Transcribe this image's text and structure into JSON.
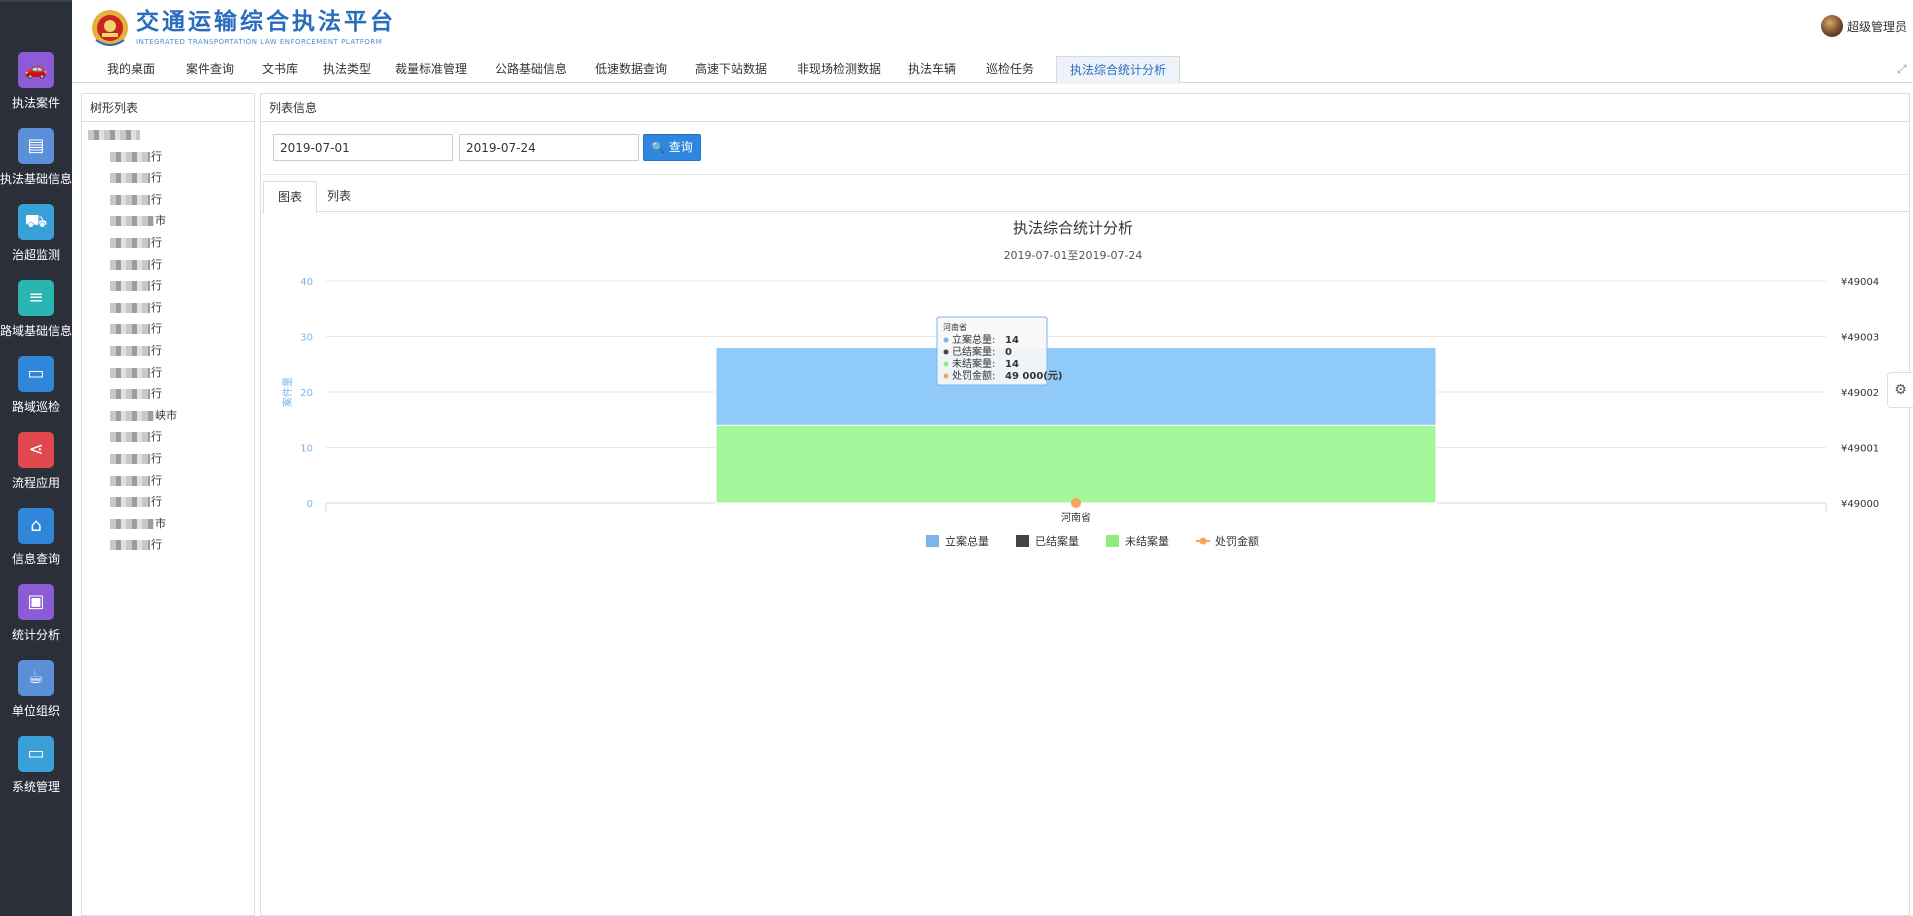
{
  "header": {
    "title_cn": "交通运输综合执法平台",
    "title_en": "INTEGRATED TRANSPORTATION LAW ENFORCEMENT PLATFORM",
    "user_name": "超级管理员"
  },
  "sidebar": {
    "items": [
      {
        "label": "执法案件",
        "icon": "car-icon",
        "color": "#8b5cd6"
      },
      {
        "label": "执法基础信息",
        "icon": "id-card-icon",
        "color": "#5b8fd8"
      },
      {
        "label": "治超监测",
        "icon": "truck-icon",
        "color": "#3aa0d8"
      },
      {
        "label": "路域基础信息",
        "icon": "list-icon",
        "color": "#2bb5b0"
      },
      {
        "label": "路域巡检",
        "icon": "monitor-icon",
        "color": "#2f86d8"
      },
      {
        "label": "流程应用",
        "icon": "share-icon",
        "color": "#e0484e"
      },
      {
        "label": "信息查询",
        "icon": "bath-icon",
        "color": "#2f86d8"
      },
      {
        "label": "统计分析",
        "icon": "chip-icon",
        "color": "#8b5cd6"
      },
      {
        "label": "单位组织",
        "icon": "coffee-icon",
        "color": "#5b8fd8"
      },
      {
        "label": "系统管理",
        "icon": "monitor-icon",
        "color": "#3aa0d8"
      }
    ]
  },
  "nav": {
    "tabs": [
      "我的桌面",
      "案件查询",
      "文书库",
      "执法类型",
      "裁量标准管理",
      "公路基础信息",
      "低速数据查询",
      "高速下站数据",
      "非现场检测数据",
      "执法车辆",
      "巡检任务",
      "执法综合统计分析"
    ],
    "active_index": 11
  },
  "tree": {
    "title": "树形列表",
    "rows": [
      "",
      "行",
      "行",
      "行",
      "市",
      "行",
      "行",
      "行",
      "行",
      "行",
      "行",
      "行",
      "行",
      "峡市",
      "行",
      "行",
      "行",
      "行",
      "市",
      "行"
    ]
  },
  "main": {
    "title": "列表信息",
    "start_date": "2019-07-01",
    "end_date": "2019-07-24",
    "query_label": "查询",
    "subtabs": [
      "图表",
      "列表"
    ],
    "active_subtab": 0
  },
  "chart_data": {
    "type": "bar",
    "title": "执法综合统计分析",
    "subtitle": "2019-07-01至2019-07-24",
    "categories": [
      "河南省"
    ],
    "ylabel": "案件量",
    "ylim": [
      0,
      40
    ],
    "yticks": [
      0,
      10,
      20,
      30,
      40
    ],
    "y2lim": [
      49000,
      49004
    ],
    "y2ticks": [
      "¥49000",
      "¥49001",
      "¥49002",
      "¥49003",
      "¥49004"
    ],
    "stacked": true,
    "series": [
      {
        "name": "立案总量",
        "values": [
          14
        ],
        "color": "#90caf9",
        "stack": "cases"
      },
      {
        "name": "已结案量",
        "values": [
          0
        ],
        "color": "#434348",
        "stack": "cases"
      },
      {
        "name": "未结案量",
        "values": [
          14
        ],
        "color": "#a5f59a",
        "stack": "cases"
      },
      {
        "name": "处罚金额",
        "values": [
          49000
        ],
        "color": "#f7a35c",
        "type": "line",
        "axis": "right"
      }
    ],
    "tooltip": {
      "category": "河南省",
      "lines": [
        {
          "name": "立案总量",
          "value": "14",
          "color": "#7cb5ec"
        },
        {
          "name": "已结案量",
          "value": "0",
          "color": "#434348"
        },
        {
          "name": "未结案量",
          "value": "14",
          "color": "#90ed7d"
        },
        {
          "name": "处罚金额",
          "value": "49 000(元)",
          "color": "#f7a35c"
        }
      ]
    },
    "legend": [
      "立案总量",
      "已结案量",
      "未结案量",
      "处罚金额"
    ],
    "legend_position": "bottom"
  }
}
